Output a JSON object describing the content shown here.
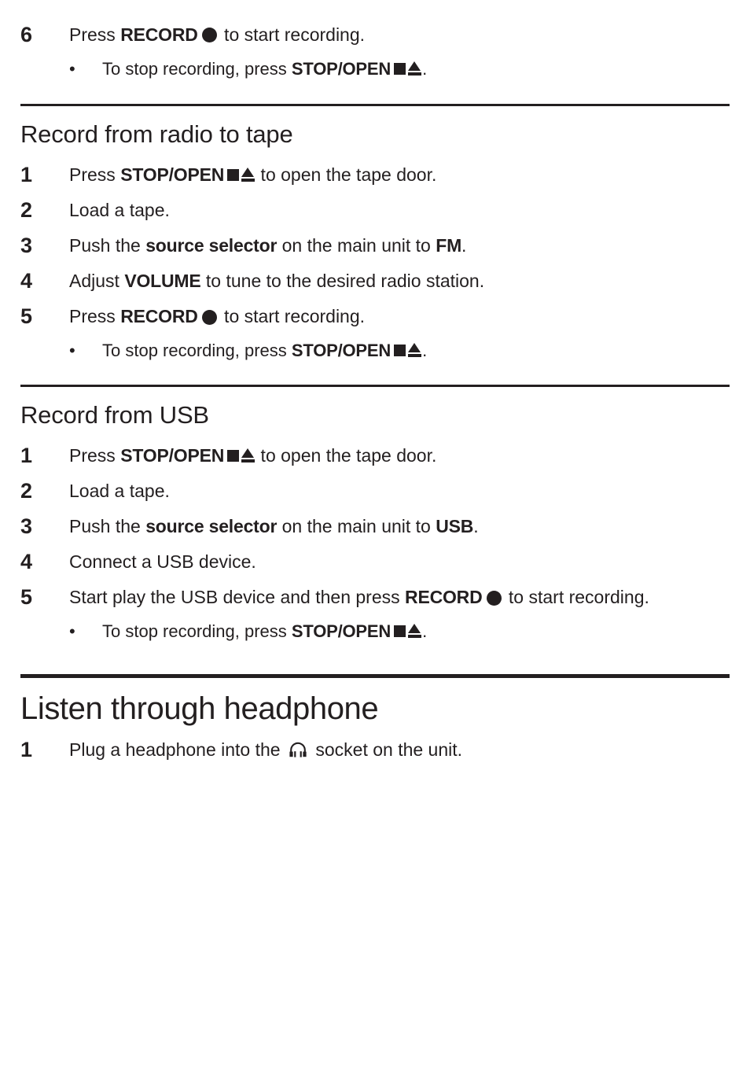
{
  "document": {
    "type": "product-manual-page",
    "language": "en",
    "text_color": "#231f20",
    "background_color": "#ffffff"
  },
  "icons": {
    "record": "record-circle-icon",
    "stop": "stop-square-icon",
    "eject": "eject-triangle-icon",
    "headphone": "headphone-icon"
  },
  "top_continued_step": {
    "number": "6",
    "parts": {
      "before": "Press ",
      "bold": "RECORD",
      "after": " to start recording."
    },
    "bullet": {
      "marker": "•",
      "before": "To stop recording, press ",
      "bold": "STOP/OPEN",
      "after": "."
    }
  },
  "sections": [
    {
      "heading": "Record from radio to tape",
      "steps": [
        {
          "number": "1",
          "segments": [
            {
              "t": "Press ",
              "bold": false
            },
            {
              "t": "STOP/OPEN",
              "bold": true
            },
            {
              "t": " to open the tape door.",
              "bold": false
            }
          ]
        },
        {
          "number": "2",
          "segments": [
            {
              "t": "Load a tape.",
              "bold": false
            }
          ]
        },
        {
          "number": "3",
          "segments": [
            {
              "t": "Push the ",
              "bold": false
            },
            {
              "t": "source selector",
              "bold": true
            },
            {
              "t": " on the main unit to ",
              "bold": false
            },
            {
              "t": "FM",
              "bold": true
            },
            {
              "t": ".",
              "bold": false
            }
          ]
        },
        {
          "number": "4",
          "segments": [
            {
              "t": "Adjust ",
              "bold": false
            },
            {
              "t": "VOLUME",
              "bold": true
            },
            {
              "t": " to tune to the desired radio station.",
              "bold": false
            }
          ]
        },
        {
          "number": "5",
          "segments": [
            {
              "t": "Press ",
              "bold": false
            },
            {
              "t": "RECORD",
              "bold": true
            },
            {
              "t": " to start recording.",
              "bold": false
            }
          ]
        }
      ],
      "bullet": {
        "marker": "•",
        "before": "To stop recording, press ",
        "bold": "STOP/OPEN",
        "after": "."
      }
    },
    {
      "heading": "Record from USB",
      "steps": [
        {
          "number": "1",
          "segments": [
            {
              "t": "Press ",
              "bold": false
            },
            {
              "t": "STOP/OPEN",
              "bold": true
            },
            {
              "t": " to open the tape door.",
              "bold": false
            }
          ]
        },
        {
          "number": "2",
          "segments": [
            {
              "t": "Load a tape.",
              "bold": false
            }
          ]
        },
        {
          "number": "3",
          "segments": [
            {
              "t": "Push the ",
              "bold": false
            },
            {
              "t": "source selector",
              "bold": true
            },
            {
              "t": " on the main unit to ",
              "bold": false
            },
            {
              "t": "USB",
              "bold": true
            },
            {
              "t": ".",
              "bold": false
            }
          ]
        },
        {
          "number": "4",
          "segments": [
            {
              "t": "Connect a USB device.",
              "bold": false
            }
          ]
        },
        {
          "number": "5",
          "segments": [
            {
              "t": "Start play the USB device and then press ",
              "bold": false
            },
            {
              "t": "RECORD",
              "bold": true
            },
            {
              "t": " to start recording.",
              "bold": false
            }
          ]
        }
      ],
      "bullet": {
        "marker": "•",
        "before": "To stop recording, press ",
        "bold": "STOP/OPEN",
        "after": "."
      }
    }
  ],
  "chapter": {
    "heading": "Listen through headphone",
    "step": {
      "number": "1",
      "before": "Plug a headphone into the ",
      "after": " socket on the unit."
    }
  },
  "labels": {
    "record_button": "RECORD",
    "stop_open_button": "STOP/OPEN",
    "source_selector": "source selector",
    "volume": "VOLUME",
    "fm": "FM",
    "usb": "USB"
  }
}
